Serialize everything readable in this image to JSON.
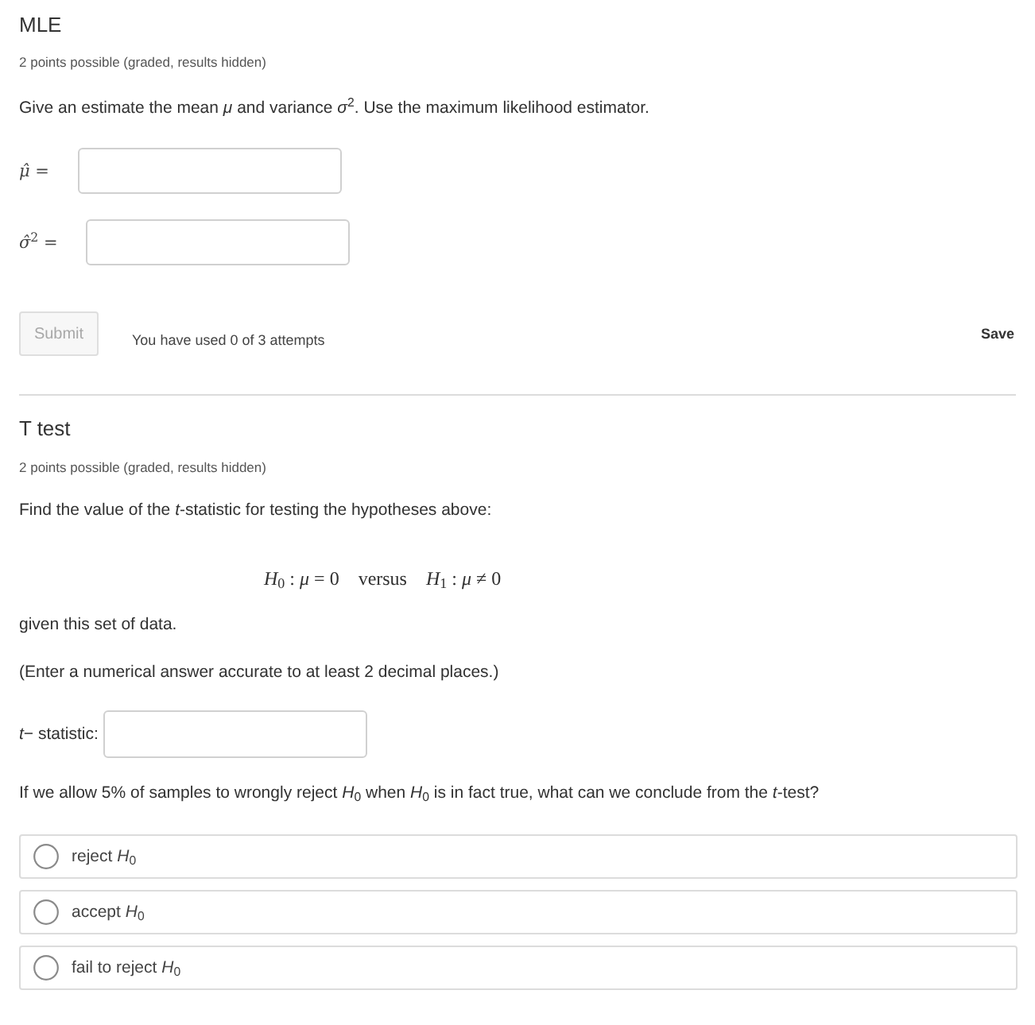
{
  "mle": {
    "title": "MLE",
    "meta": "2 points possible (graded, results hidden)",
    "prompt": "Give an estimate the mean *μ* and variance *σ*$^{2}$. Use the maximum likelihood estimator.",
    "fields": [
      {
        "label": "*μ̂* ="
      },
      {
        "label": "*σ̂*$^{2}$ ="
      }
    ],
    "submit": {
      "label": "Submit",
      "disabled": true
    },
    "attempts": "You have used 0 of 3 attempts",
    "save": "Save"
  },
  "t_test": {
    "title": "T test",
    "meta": "2 points possible (graded, results hidden)",
    "prompt": "Find the value of the *t*-statistic for testing the hypotheses above:",
    "equation": "*H*$_{0}$ : *μ* = 0    versus    *H*$_{1}$ : *μ* ≠ 0",
    "after": "given this set of data.",
    "instruction": "(Enter a numerical answer accurate to at least 2 decimal places.)",
    "field": {
      "label": "*t*− statistic:"
    },
    "question": "If we allow 5% of samples to wrongly reject *H*$_{0}$ when *H*$_{0}$ is in fact true, what can we conclude from the *t*-test?",
    "options": [
      {
        "label": "reject *H*$_{0}$",
        "selected": false
      },
      {
        "label": "accept *H*$_{0}$",
        "selected": false
      },
      {
        "label": "fail to reject *H*$_{0}$",
        "selected": false
      }
    ]
  }
}
